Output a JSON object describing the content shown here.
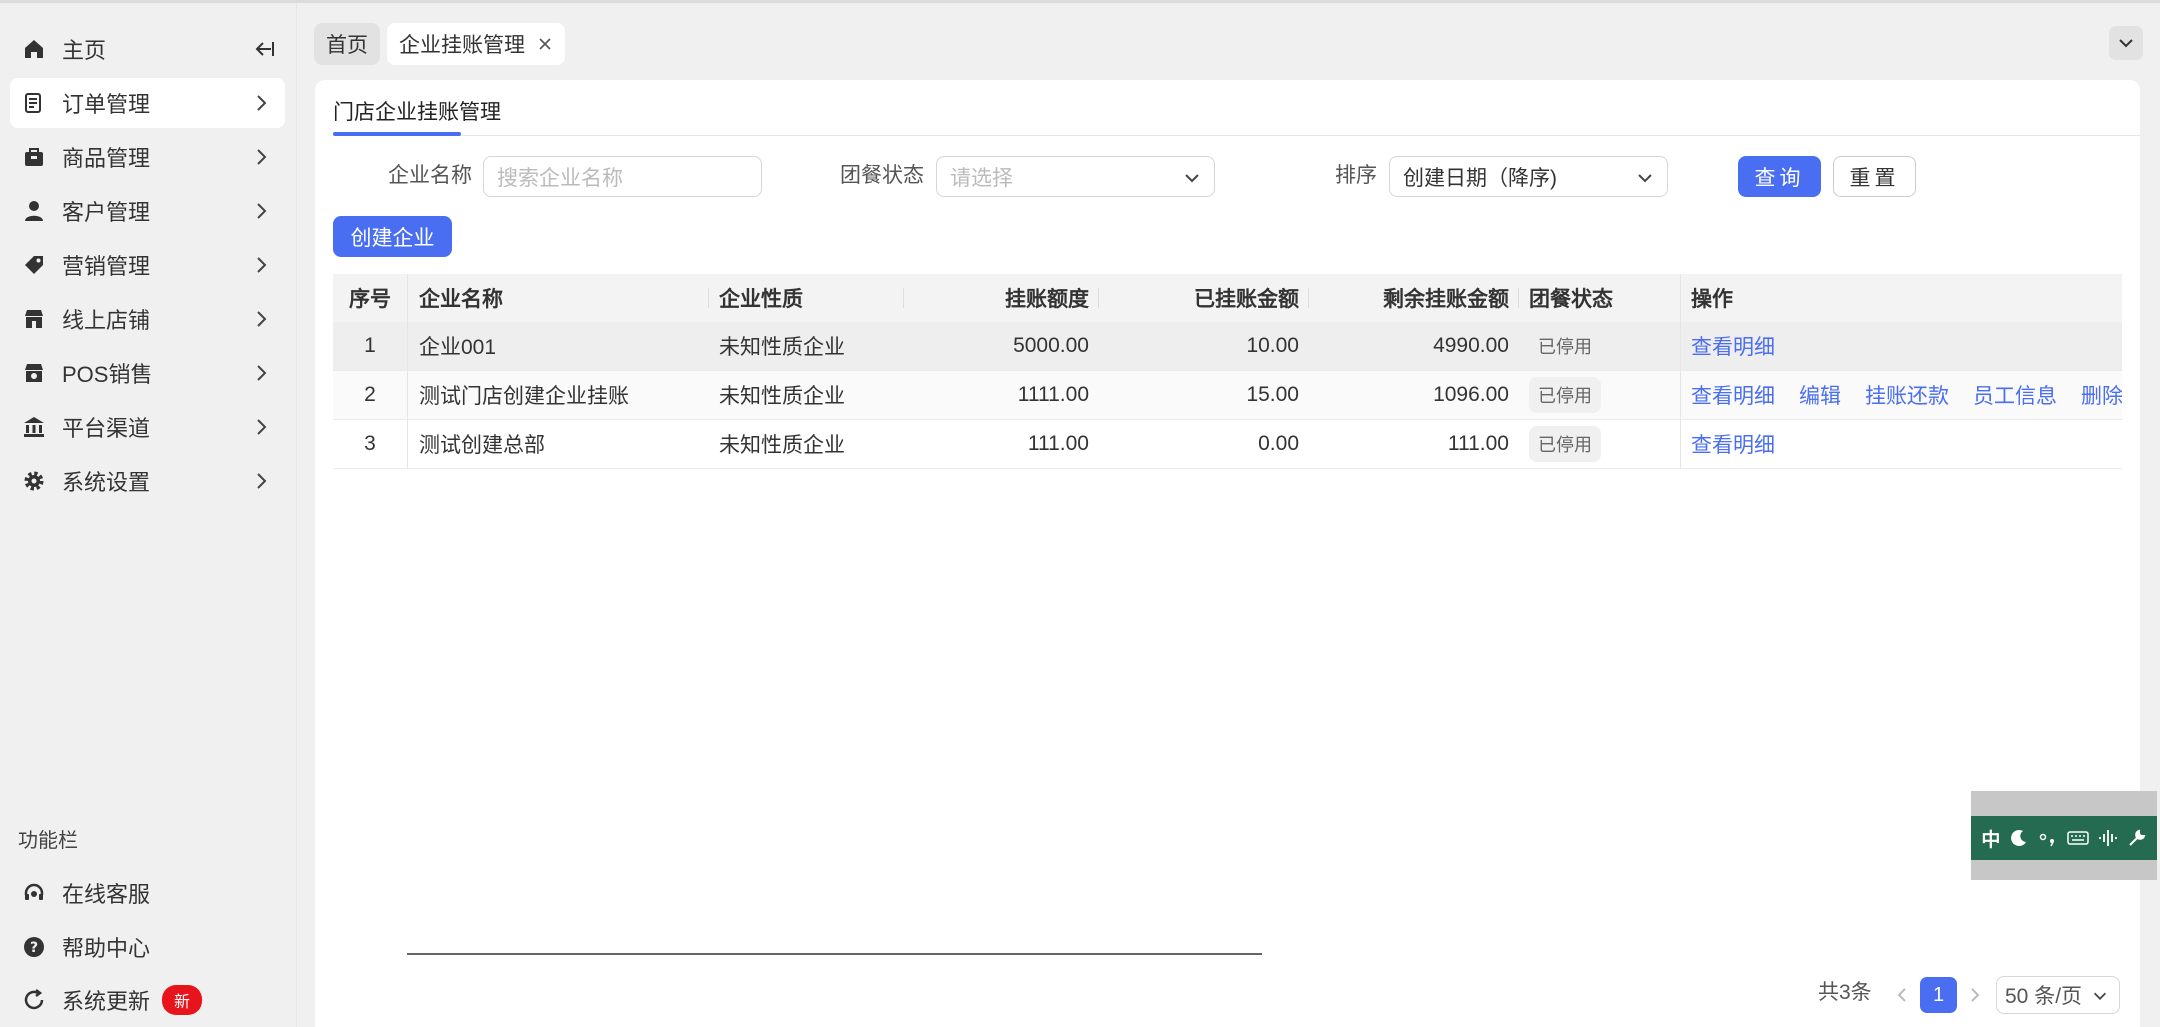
{
  "sidebar": {
    "items": [
      {
        "label": "主页",
        "icon": "home-icon"
      },
      {
        "label": "订单管理",
        "icon": "order-icon"
      },
      {
        "label": "商品管理",
        "icon": "box-icon"
      },
      {
        "label": "客户管理",
        "icon": "user-icon"
      },
      {
        "label": "营销管理",
        "icon": "tag-icon"
      },
      {
        "label": "线上店铺",
        "icon": "store-icon"
      },
      {
        "label": "POS销售",
        "icon": "pos-store-icon"
      },
      {
        "label": "平台渠道",
        "icon": "bank-icon"
      },
      {
        "label": "系统设置",
        "icon": "gear-icon"
      }
    ],
    "func_title": "功能栏",
    "func_items": [
      {
        "label": "在线客服",
        "icon": "headset-icon"
      },
      {
        "label": "帮助中心",
        "icon": "help-icon"
      },
      {
        "label": "系统更新",
        "icon": "refresh-icon",
        "badge": "新"
      }
    ]
  },
  "tabs": {
    "home": "首页",
    "current": "企业挂账管理"
  },
  "panel": {
    "tab_label": "门店企业挂账管理"
  },
  "filters": {
    "name_label": "企业名称",
    "name_placeholder": "搜索企业名称",
    "status_label": "团餐状态",
    "status_placeholder": "请选择",
    "sort_label": "排序",
    "sort_value": "创建日期（降序)",
    "query_button": "查询",
    "reset_button": "重置",
    "create_button": "创建企业"
  },
  "table": {
    "headers": [
      "序号",
      "企业名称",
      "企业性质",
      "挂账额度",
      "已挂账金额",
      "剩余挂账金额",
      "团餐状态",
      "操作"
    ],
    "rows": [
      {
        "idx": "1",
        "name": "企业001",
        "type": "未知性质企业",
        "quota": "5000.00",
        "used": "10.00",
        "left": "4990.00",
        "status": "已停用",
        "ops": [
          "查看明细"
        ]
      },
      {
        "idx": "2",
        "name": "测试门店创建企业挂账",
        "type": "未知性质企业",
        "quota": "1111.00",
        "used": "15.00",
        "left": "1096.00",
        "status": "已停用",
        "ops": [
          "查看明细",
          "编辑",
          "挂账还款",
          "员工信息",
          "删除"
        ]
      },
      {
        "idx": "3",
        "name": "测试创建总部",
        "type": "未知性质企业",
        "quota": "111.00",
        "used": "0.00",
        "left": "111.00",
        "status": "已停用",
        "ops": [
          "查看明细"
        ]
      }
    ]
  },
  "pagination": {
    "total": "共3条",
    "current_page": "1",
    "page_size": "50 条/页"
  },
  "ime": {
    "lang": "中"
  },
  "colors": {
    "accent": "#4a6ef2",
    "badge": "#e8141b",
    "ime_bar": "#256b52"
  }
}
